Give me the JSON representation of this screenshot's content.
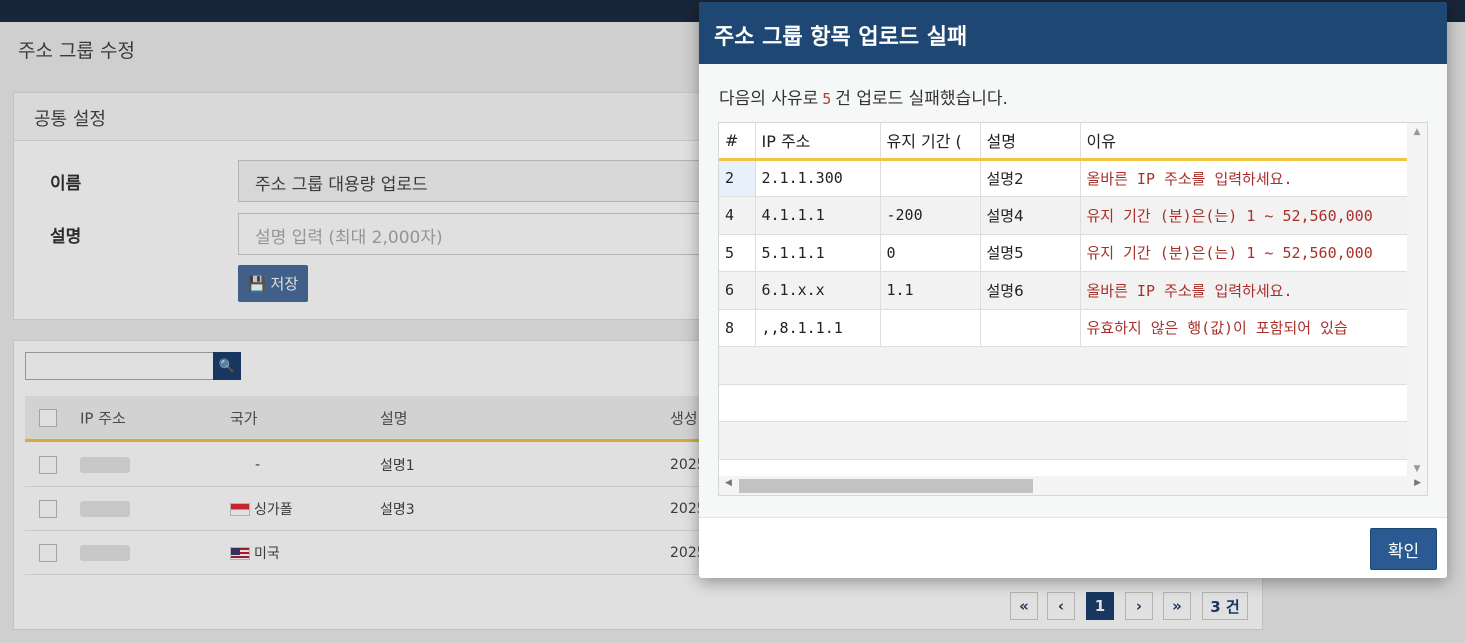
{
  "page": {
    "title": "주소 그룹 수정",
    "common_settings": "공통 설정",
    "name_label": "이름",
    "name_value": "주소 그룹 대용량 업로드",
    "desc_label": "설명",
    "desc_placeholder": "설명 입력 (최대 2,000자)",
    "save_label": "저장"
  },
  "list": {
    "columns": [
      "IP 주소",
      "국가",
      "설명",
      "생성"
    ],
    "rows": [
      {
        "country": "-",
        "description": "설명1",
        "created": "2025"
      },
      {
        "country": "싱가폴",
        "description": "설명3",
        "created": "2025"
      },
      {
        "country": "미국",
        "description": "",
        "created": "2025"
      }
    ]
  },
  "pagination": {
    "first": "«",
    "prev": "‹",
    "current": "1",
    "next": "›",
    "last": "»",
    "total": "3 건"
  },
  "modal": {
    "title": "주소 그룹 항목 업로드 실패",
    "message_prefix": "다음의 사유로",
    "message_count": "5",
    "message_suffix": "건 업로드 실패했습니다.",
    "columns": [
      "#",
      "IP 주소",
      "유지 기간 (",
      "설명",
      "이유"
    ],
    "rows": [
      {
        "num": "2",
        "ip": "2.1.1.300",
        "duration": "",
        "desc": "설명2",
        "reason": "올바른 IP 주소를 입력하세요."
      },
      {
        "num": "4",
        "ip": "4.1.1.1",
        "duration": "-200",
        "desc": "설명4",
        "reason": "유지 기간 (분)은(는) 1 ~ 52,560,000"
      },
      {
        "num": "5",
        "ip": "5.1.1.1",
        "duration": "0",
        "desc": "설명5",
        "reason": "유지 기간 (분)은(는) 1 ~ 52,560,000"
      },
      {
        "num": "6",
        "ip": "6.1.x.x",
        "duration": "1.1",
        "desc": "설명6",
        "reason": "올바른 IP 주소를 입력하세요."
      },
      {
        "num": "8",
        "ip": ",,8.1.1.1",
        "duration": "",
        "desc": "",
        "reason": "유효하지 않은 행(값)이 포함되어 있습"
      }
    ],
    "ok_label": "확인"
  }
}
